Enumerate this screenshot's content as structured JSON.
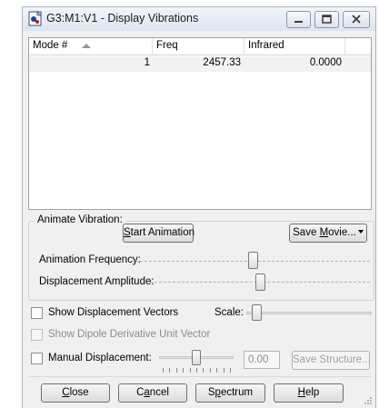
{
  "window": {
    "title": "G3:M1:V1 - Display Vibrations"
  },
  "table": {
    "columns": [
      "Mode #",
      "Freq",
      "Infrared"
    ],
    "rows": [
      {
        "mode": "1",
        "freq": "2457.33",
        "infrared": "0.0000"
      }
    ]
  },
  "animate": {
    "group_label": "Animate Vibration:",
    "start_button": {
      "pre": "",
      "key": "S",
      "post": "tart Animation"
    },
    "save_movie_button": {
      "pre": "Save ",
      "key": "M",
      "post": "ovie..."
    },
    "frequency_label": "Animation Frequency:",
    "amplitude_label": "Displacement Amplitude:",
    "frequency_level": 0.5,
    "amplitude_level": 0.5
  },
  "options": {
    "show_displacement_vectors": {
      "label": "Show Displacement Vectors",
      "checked": false
    },
    "scale_label": "Scale:",
    "scale_level": 0.05,
    "show_dipole": {
      "label": "Show Dipole Derivative Unit Vector",
      "checked": false,
      "enabled": false
    },
    "manual_displacement": {
      "label": "Manual Displacement:",
      "checked": false
    },
    "manual_level": 0.5,
    "manual_value": "0.00",
    "save_structure_label": "Save Structure..."
  },
  "footer": {
    "close": {
      "pre": "",
      "key": "C",
      "post": "lose"
    },
    "cancel": {
      "pre": "C",
      "key": "a",
      "post": "ncel"
    },
    "spectrum": {
      "pre": "S",
      "key": "p",
      "post": "ectrum"
    },
    "help": {
      "pre": "",
      "key": "H",
      "post": "elp"
    }
  }
}
